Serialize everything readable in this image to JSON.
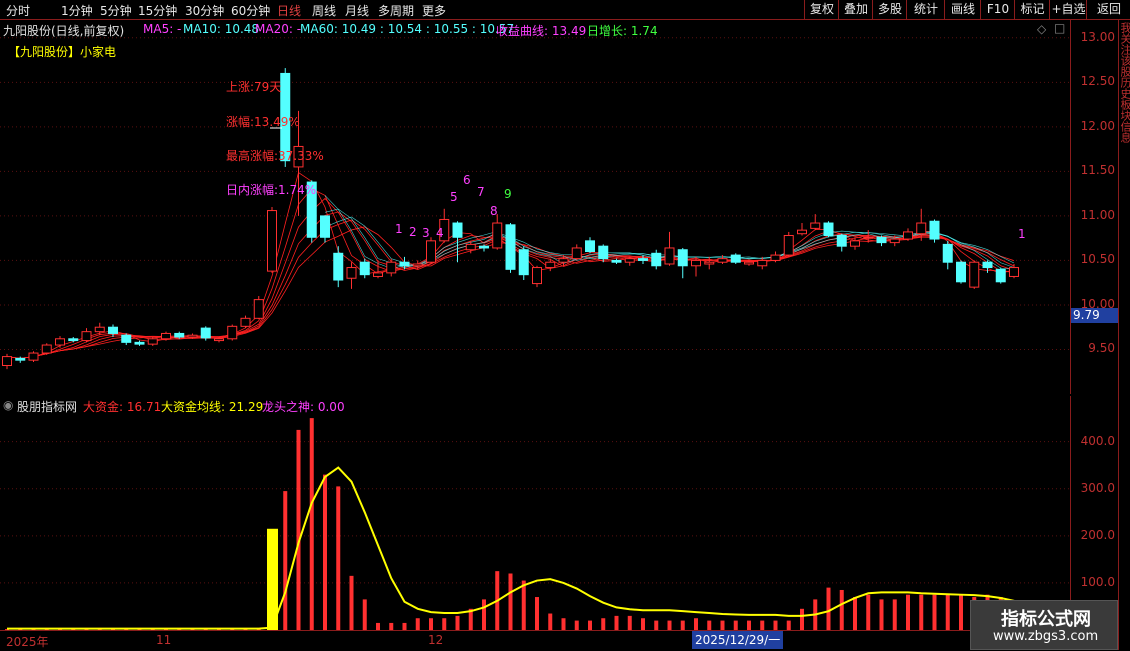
{
  "toolbar": {
    "periods": [
      "分时",
      "1分钟",
      "5分钟",
      "15分钟",
      "30分钟",
      "60分钟",
      "日线",
      "周线",
      "月线",
      "多周期",
      "更多"
    ],
    "active_period": "日线",
    "right_buttons": [
      "复权",
      "叠加",
      "多股",
      "统计",
      "画线",
      "F10",
      "标记",
      "+自选",
      "返回"
    ]
  },
  "header": {
    "stock_title": "九阳股份(日线,前复权)",
    "ma5": "MA5: -",
    "ma10": "MA10: 10.48",
    "ma20": "MA20: -",
    "ma60": "MA60: 10.49 : 10.54 : 10.55 : 10.57",
    "profit_curve": "收益曲线: 13.49",
    "daily_growth": "日增长: 1.74",
    "sector_tag": "【九阳股份】小家电"
  },
  "annotations": {
    "rise_days": "上涨:79天",
    "amplitude": "涨幅:13.49%",
    "max_rise": "最高涨幅:37.33%",
    "intraday_rise": "日内涨幅:1.74%",
    "count_labels": [
      "1",
      "2",
      "3",
      "4",
      "5",
      "6",
      "7",
      "8",
      "9"
    ],
    "right_count": "1"
  },
  "price_axis": {
    "ticks": [
      "13.00",
      "12.50",
      "12.00",
      "11.50",
      "11.00",
      "10.50",
      "10.00",
      "9.50"
    ],
    "current_price": "9.79"
  },
  "sub_panel": {
    "indicator_name": "股朋指标网",
    "big_fund": "大资金: 16.71",
    "big_fund_avg": "大资金均线: 21.29",
    "dragon_head": "龙头之神: 0.00",
    "ticks": [
      "400.0",
      "300.0",
      "200.0",
      "100.0"
    ]
  },
  "date_axis": {
    "labels": [
      "2025年",
      "11",
      "12",
      "2025/12/29/一"
    ]
  },
  "watermark": {
    "title": "指标公式网",
    "url": "www.zbgs3.com"
  },
  "right_strip_text": "我关注该股历史板块信息",
  "colors": {
    "up": "#ff3030",
    "down": "#54ffff",
    "yellow": "#ffff00",
    "magenta": "#ff40ff",
    "green": "#40ff40",
    "grid": "#8a1c1c"
  },
  "chart_data": {
    "type": "candlestick",
    "price_ylim": [
      9.0,
      13.2
    ],
    "candles": [
      {
        "o": 9.32,
        "c": 9.42,
        "h": 9.45,
        "l": 9.28
      },
      {
        "o": 9.4,
        "c": 9.38,
        "h": 9.42,
        "l": 9.35
      },
      {
        "o": 9.38,
        "c": 9.46,
        "h": 9.48,
        "l": 9.36
      },
      {
        "o": 9.46,
        "c": 9.55,
        "h": 9.57,
        "l": 9.44
      },
      {
        "o": 9.55,
        "c": 9.62,
        "h": 9.65,
        "l": 9.52
      },
      {
        "o": 9.62,
        "c": 9.6,
        "h": 9.64,
        "l": 9.58
      },
      {
        "o": 9.6,
        "c": 9.7,
        "h": 9.74,
        "l": 9.58
      },
      {
        "o": 9.7,
        "c": 9.75,
        "h": 9.8,
        "l": 9.66
      },
      {
        "o": 9.75,
        "c": 9.68,
        "h": 9.78,
        "l": 9.64
      },
      {
        "o": 9.66,
        "c": 9.58,
        "h": 9.68,
        "l": 9.55
      },
      {
        "o": 9.58,
        "c": 9.56,
        "h": 9.6,
        "l": 9.54
      },
      {
        "o": 9.56,
        "c": 9.62,
        "h": 9.64,
        "l": 9.54
      },
      {
        "o": 9.62,
        "c": 9.68,
        "h": 9.7,
        "l": 9.6
      },
      {
        "o": 9.68,
        "c": 9.64,
        "h": 9.7,
        "l": 9.62
      },
      {
        "o": 9.64,
        "c": 9.66,
        "h": 9.68,
        "l": 9.62
      },
      {
        "o": 9.74,
        "c": 9.63,
        "h": 9.76,
        "l": 9.6
      },
      {
        "o": 9.6,
        "c": 9.62,
        "h": 9.64,
        "l": 9.58
      },
      {
        "o": 9.62,
        "c": 9.76,
        "h": 9.78,
        "l": 9.6
      },
      {
        "o": 9.76,
        "c": 9.85,
        "h": 9.88,
        "l": 9.74
      },
      {
        "o": 9.85,
        "c": 10.06,
        "h": 10.1,
        "l": 9.84
      },
      {
        "o": 10.38,
        "c": 11.06,
        "h": 11.1,
        "l": 10.36
      },
      {
        "o": 12.6,
        "c": 11.62,
        "h": 12.66,
        "l": 11.55
      },
      {
        "o": 11.55,
        "c": 11.78,
        "h": 12.18,
        "l": 11.0
      },
      {
        "o": 11.38,
        "c": 10.76,
        "h": 11.4,
        "l": 10.7
      },
      {
        "o": 11.0,
        "c": 10.76,
        "h": 11.0,
        "l": 10.7
      },
      {
        "o": 10.58,
        "c": 10.28,
        "h": 10.66,
        "l": 10.2
      },
      {
        "o": 10.3,
        "c": 10.42,
        "h": 10.48,
        "l": 10.18
      },
      {
        "o": 10.48,
        "c": 10.34,
        "h": 10.52,
        "l": 10.3
      },
      {
        "o": 10.32,
        "c": 10.36,
        "h": 10.5,
        "l": 10.3
      },
      {
        "o": 10.36,
        "c": 10.48,
        "h": 10.52,
        "l": 10.32
      },
      {
        "o": 10.48,
        "c": 10.44,
        "h": 10.54,
        "l": 10.4
      },
      {
        "o": 10.44,
        "c": 10.46,
        "h": 10.5,
        "l": 10.4
      },
      {
        "o": 10.48,
        "c": 10.72,
        "h": 10.76,
        "l": 10.46
      },
      {
        "o": 10.72,
        "c": 10.96,
        "h": 11.08,
        "l": 10.7
      },
      {
        "o": 10.92,
        "c": 10.76,
        "h": 10.94,
        "l": 10.48
      },
      {
        "o": 10.62,
        "c": 10.68,
        "h": 10.72,
        "l": 10.58
      },
      {
        "o": 10.66,
        "c": 10.64,
        "h": 10.68,
        "l": 10.6
      },
      {
        "o": 10.64,
        "c": 10.92,
        "h": 11.02,
        "l": 10.62
      },
      {
        "o": 10.9,
        "c": 10.4,
        "h": 10.92,
        "l": 10.36
      },
      {
        "o": 10.62,
        "c": 10.34,
        "h": 10.66,
        "l": 10.28
      },
      {
        "o": 10.24,
        "c": 10.42,
        "h": 10.44,
        "l": 10.2
      },
      {
        "o": 10.42,
        "c": 10.48,
        "h": 10.52,
        "l": 10.38
      },
      {
        "o": 10.48,
        "c": 10.52,
        "h": 10.56,
        "l": 10.44
      },
      {
        "o": 10.52,
        "c": 10.64,
        "h": 10.68,
        "l": 10.5
      },
      {
        "o": 10.72,
        "c": 10.6,
        "h": 10.76,
        "l": 10.58
      },
      {
        "o": 10.66,
        "c": 10.52,
        "h": 10.68,
        "l": 10.48
      },
      {
        "o": 10.5,
        "c": 10.48,
        "h": 10.52,
        "l": 10.46
      },
      {
        "o": 10.48,
        "c": 10.52,
        "h": 10.54,
        "l": 10.44
      },
      {
        "o": 10.52,
        "c": 10.5,
        "h": 10.56,
        "l": 10.46
      },
      {
        "o": 10.58,
        "c": 10.44,
        "h": 10.62,
        "l": 10.4
      },
      {
        "o": 10.46,
        "c": 10.64,
        "h": 10.82,
        "l": 10.44
      },
      {
        "o": 10.62,
        "c": 10.44,
        "h": 10.64,
        "l": 10.3
      },
      {
        "o": 10.44,
        "c": 10.5,
        "h": 10.54,
        "l": 10.32
      },
      {
        "o": 10.46,
        "c": 10.48,
        "h": 10.54,
        "l": 10.4
      },
      {
        "o": 10.48,
        "c": 10.52,
        "h": 10.56,
        "l": 10.46
      },
      {
        "o": 10.56,
        "c": 10.48,
        "h": 10.58,
        "l": 10.46
      },
      {
        "o": 10.46,
        "c": 10.48,
        "h": 10.5,
        "l": 10.44
      },
      {
        "o": 10.44,
        "c": 10.5,
        "h": 10.54,
        "l": 10.4
      },
      {
        "o": 10.5,
        "c": 10.56,
        "h": 10.6,
        "l": 10.48
      },
      {
        "o": 10.56,
        "c": 10.78,
        "h": 10.82,
        "l": 10.54
      },
      {
        "o": 10.8,
        "c": 10.84,
        "h": 10.92,
        "l": 10.78
      },
      {
        "o": 10.86,
        "c": 10.92,
        "h": 11.02,
        "l": 10.84
      },
      {
        "o": 10.92,
        "c": 10.78,
        "h": 10.94,
        "l": 10.76
      },
      {
        "o": 10.78,
        "c": 10.66,
        "h": 10.8,
        "l": 10.6
      },
      {
        "o": 10.66,
        "c": 10.72,
        "h": 10.76,
        "l": 10.62
      },
      {
        "o": 10.76,
        "c": 10.76,
        "h": 10.84,
        "l": 10.7
      },
      {
        "o": 10.76,
        "c": 10.7,
        "h": 10.78,
        "l": 10.66
      },
      {
        "o": 10.7,
        "c": 10.74,
        "h": 10.78,
        "l": 10.66
      },
      {
        "o": 10.74,
        "c": 10.82,
        "h": 10.86,
        "l": 10.72
      },
      {
        "o": 10.8,
        "c": 10.92,
        "h": 11.08,
        "l": 10.72
      },
      {
        "o": 10.94,
        "c": 10.74,
        "h": 10.96,
        "l": 10.7
      },
      {
        "o": 10.68,
        "c": 10.48,
        "h": 10.72,
        "l": 10.4
      },
      {
        "o": 10.48,
        "c": 10.26,
        "h": 10.5,
        "l": 10.24
      },
      {
        "o": 10.2,
        "c": 10.48,
        "h": 10.5,
        "l": 10.18
      },
      {
        "o": 10.48,
        "c": 10.42,
        "h": 10.5,
        "l": 10.36
      },
      {
        "o": 10.4,
        "c": 10.26,
        "h": 10.42,
        "l": 10.24
      },
      {
        "o": 10.32,
        "c": 10.42,
        "h": 10.46,
        "l": 10.3
      }
    ],
    "big_fund_series_ylim": [
      0,
      480
    ],
    "big_fund_values": [
      2,
      2,
      2,
      2,
      2,
      2,
      2,
      2,
      2,
      2,
      2,
      2,
      2,
      2,
      2,
      2,
      2,
      2,
      2,
      2,
      5,
      295,
      425,
      450,
      330,
      305,
      115,
      65,
      15,
      15,
      15,
      25,
      25,
      25,
      30,
      45,
      65,
      125,
      120,
      105,
      70,
      35,
      25,
      20,
      20,
      25,
      30,
      30,
      25,
      20,
      20,
      20,
      25,
      20,
      20,
      20,
      20,
      20,
      20,
      20,
      45,
      65,
      90,
      85,
      70,
      75,
      65,
      65,
      75,
      75,
      75,
      75,
      75,
      70,
      75,
      70,
      40,
      18
    ],
    "dragon_head_index": 20,
    "dragon_head_value": 215,
    "big_fund_avg_values": [
      3,
      3,
      3,
      3,
      3,
      3,
      3,
      3,
      3,
      3,
      3,
      3,
      3,
      3,
      3,
      3,
      3,
      3,
      3,
      3,
      5,
      80,
      185,
      270,
      325,
      345,
      315,
      250,
      180,
      110,
      60,
      45,
      38,
      36,
      36,
      40,
      48,
      62,
      80,
      95,
      105,
      108,
      100,
      88,
      72,
      58,
      48,
      44,
      42,
      42,
      42,
      40,
      38,
      36,
      34,
      33,
      32,
      32,
      32,
      30,
      30,
      33,
      40,
      55,
      68,
      78,
      80,
      80,
      80,
      78,
      77,
      76,
      75,
      74,
      72,
      68,
      62,
      55
    ]
  }
}
